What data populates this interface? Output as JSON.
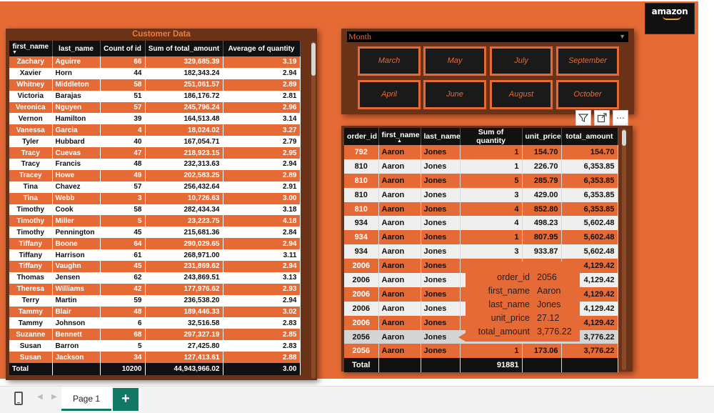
{
  "logo": {
    "text": "amazon"
  },
  "customer_table": {
    "title": "Customer Data",
    "columns": [
      "first_name",
      "last_name",
      "Count of id",
      "Sum of total_amount",
      "Average of quantity"
    ],
    "rows": [
      [
        "Zachary",
        "Aguirre",
        "66",
        "329,685.39",
        "3.19"
      ],
      [
        "Xavier",
        "Horn",
        "44",
        "182,343.24",
        "2.94"
      ],
      [
        "Whitney",
        "Middleton",
        "58",
        "251,061.57",
        "2.89"
      ],
      [
        "Victoria",
        "Barajas",
        "51",
        "186,176.72",
        "2.81"
      ],
      [
        "Veronica",
        "Nguyen",
        "57",
        "245,796.24",
        "2.96"
      ],
      [
        "Vernon",
        "Hamilton",
        "39",
        "164,513.48",
        "3.14"
      ],
      [
        "Vanessa",
        "Garcia",
        "4",
        "18,024.02",
        "3.27"
      ],
      [
        "Tyler",
        "Hubbard",
        "40",
        "167,054.71",
        "2.79"
      ],
      [
        "Tracy",
        "Cuevas",
        "47",
        "218,923.15",
        "2.95"
      ],
      [
        "Tracy",
        "Francis",
        "48",
        "232,313.63",
        "2.94"
      ],
      [
        "Tracey",
        "Howe",
        "49",
        "202,583.25",
        "2.89"
      ],
      [
        "Tina",
        "Chavez",
        "57",
        "256,432.64",
        "2.91"
      ],
      [
        "Tina",
        "Webb",
        "3",
        "10,726.63",
        "3.00"
      ],
      [
        "Timothy",
        "Cook",
        "58",
        "282,434.34",
        "3.18"
      ],
      [
        "Timothy",
        "Miller",
        "5",
        "23,223.75",
        "4.18"
      ],
      [
        "Timothy",
        "Pennington",
        "45",
        "215,681.36",
        "2.84"
      ],
      [
        "Tiffany",
        "Boone",
        "64",
        "290,029.65",
        "2.94"
      ],
      [
        "Tiffany",
        "Harrison",
        "61",
        "268,971.00",
        "3.11"
      ],
      [
        "Tiffany",
        "Vaughn",
        "45",
        "231,869.62",
        "2.94"
      ],
      [
        "Thomas",
        "Jensen",
        "62",
        "243,869.51",
        "3.13"
      ],
      [
        "Theresa",
        "Williams",
        "42",
        "177,976.62",
        "2.93"
      ],
      [
        "Terry",
        "Martin",
        "59",
        "236,538.20",
        "2.94"
      ],
      [
        "Tammy",
        "Blair",
        "48",
        "189,446.33",
        "3.02"
      ],
      [
        "Tammy",
        "Johnson",
        "6",
        "32,516.58",
        "2.83"
      ],
      [
        "Suzanne",
        "Bennett",
        "68",
        "297,327.19",
        "2.85"
      ],
      [
        "Susan",
        "Barron",
        "5",
        "27,425.80",
        "2.83"
      ],
      [
        "Susan",
        "Jackson",
        "34",
        "127,413.61",
        "2.88"
      ]
    ],
    "total": [
      "Total",
      "",
      "10200",
      "44,943,966.02",
      "3.00"
    ]
  },
  "month_slicer": {
    "header": "Month",
    "options": [
      "March",
      "May",
      "July",
      "September",
      "April",
      "June",
      "August",
      "October"
    ]
  },
  "visual_header": {
    "icons": [
      "filter-icon",
      "focus-mode-icon",
      "more-options-icon"
    ]
  },
  "orders_table": {
    "columns": [
      "order_id",
      "first_name",
      "last_name",
      "Sum of quantity",
      "unit_price",
      "total_amount"
    ],
    "rows": [
      [
        "792",
        "Aaron",
        "Jones",
        "1",
        "154.70",
        "154.70"
      ],
      [
        "810",
        "Aaron",
        "Jones",
        "1",
        "226.70",
        "6,353.85"
      ],
      [
        "810",
        "Aaron",
        "Jones",
        "5",
        "285.79",
        "6,353.85"
      ],
      [
        "810",
        "Aaron",
        "Jones",
        "3",
        "429.00",
        "6,353.85"
      ],
      [
        "810",
        "Aaron",
        "Jones",
        "4",
        "852.80",
        "6,353.85"
      ],
      [
        "934",
        "Aaron",
        "Jones",
        "4",
        "498.23",
        "5,602.48"
      ],
      [
        "934",
        "Aaron",
        "Jones",
        "1",
        "807.95",
        "5,602.48"
      ],
      [
        "934",
        "Aaron",
        "Jones",
        "3",
        "933.87",
        "5,602.48"
      ],
      [
        "2006",
        "Aaron",
        "Jones",
        "",
        "",
        "4,129.42"
      ],
      [
        "2006",
        "Aaron",
        "Jones",
        "",
        "",
        "4,129.42"
      ],
      [
        "2006",
        "Aaron",
        "Jones",
        "",
        "",
        "4,129.42"
      ],
      [
        "2006",
        "Aaron",
        "Jones",
        "",
        "",
        "4,129.42"
      ],
      [
        "2006",
        "Aaron",
        "Jones",
        "",
        "",
        "4,129.42"
      ],
      [
        "2056",
        "Aaron",
        "Jones",
        "",
        "",
        "3,776.22"
      ],
      [
        "2056",
        "Aaron",
        "Jones",
        "1",
        "173.06",
        "3,776.22"
      ]
    ],
    "total": [
      "Total",
      "",
      "",
      "91881",
      "",
      ""
    ]
  },
  "tooltip": {
    "fields": [
      {
        "key": "order_id",
        "value": "2056"
      },
      {
        "key": "first_name",
        "value": "Aaron"
      },
      {
        "key": "last_name",
        "value": "Jones"
      },
      {
        "key": "unit_price",
        "value": "27.12"
      },
      {
        "key": "total_amount",
        "value": "3,776.22"
      }
    ]
  },
  "tabbar": {
    "page_label": "Page 1",
    "add_label": "+"
  }
}
